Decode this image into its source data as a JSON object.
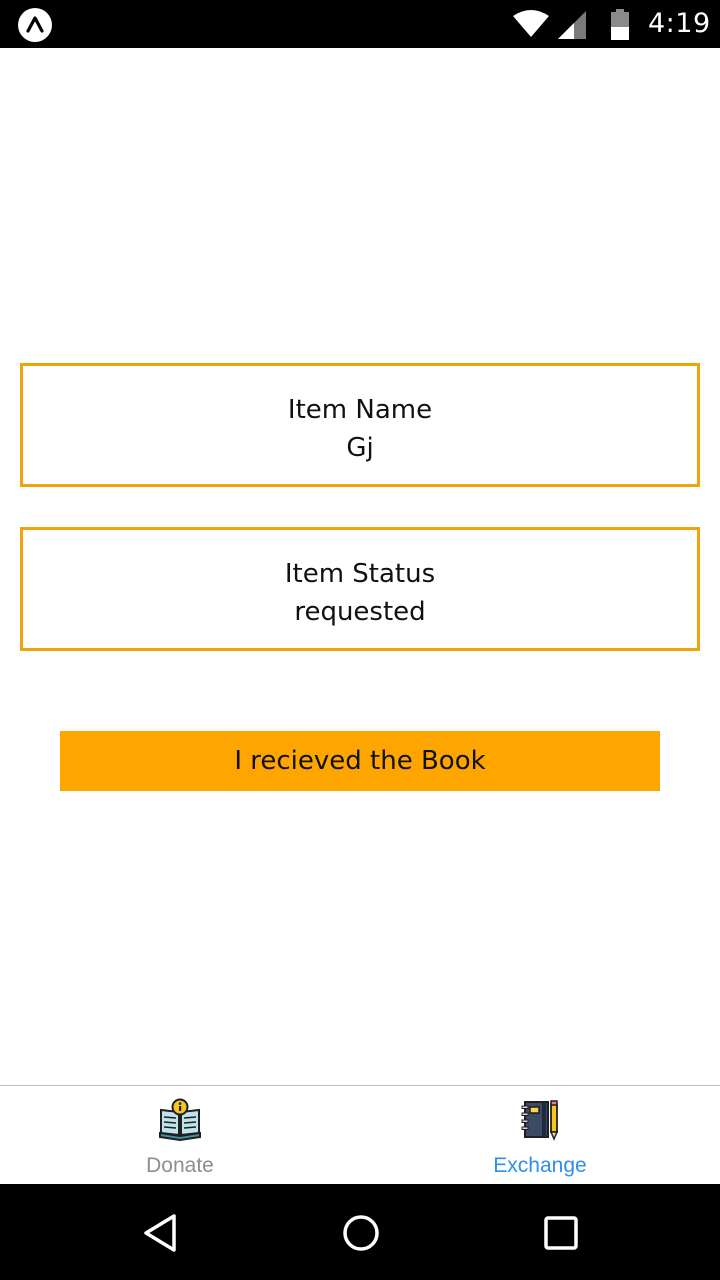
{
  "status_bar": {
    "time": "4:19",
    "icons": [
      "app-notification-icon",
      "wifi-icon",
      "cell-signal-icon",
      "battery-icon"
    ]
  },
  "item_name_card": {
    "label": "Item Name",
    "value": "Gj"
  },
  "item_status_card": {
    "label": "Item Status",
    "value": "requested"
  },
  "action_button": {
    "label": "I recieved the Book"
  },
  "tabs": [
    {
      "label": "Donate",
      "icon": "book-info-icon",
      "active": false
    },
    {
      "label": "Exchange",
      "icon": "notebook-pencil-icon",
      "active": true
    }
  ],
  "navigation": {
    "icons": [
      "back-icon",
      "home-icon",
      "recents-icon"
    ]
  },
  "colors": {
    "card_border": "#f0a30a",
    "button": "#ffa500",
    "active_tab": "#2f8fe9",
    "inactive_tab": "#8e8e8e"
  }
}
